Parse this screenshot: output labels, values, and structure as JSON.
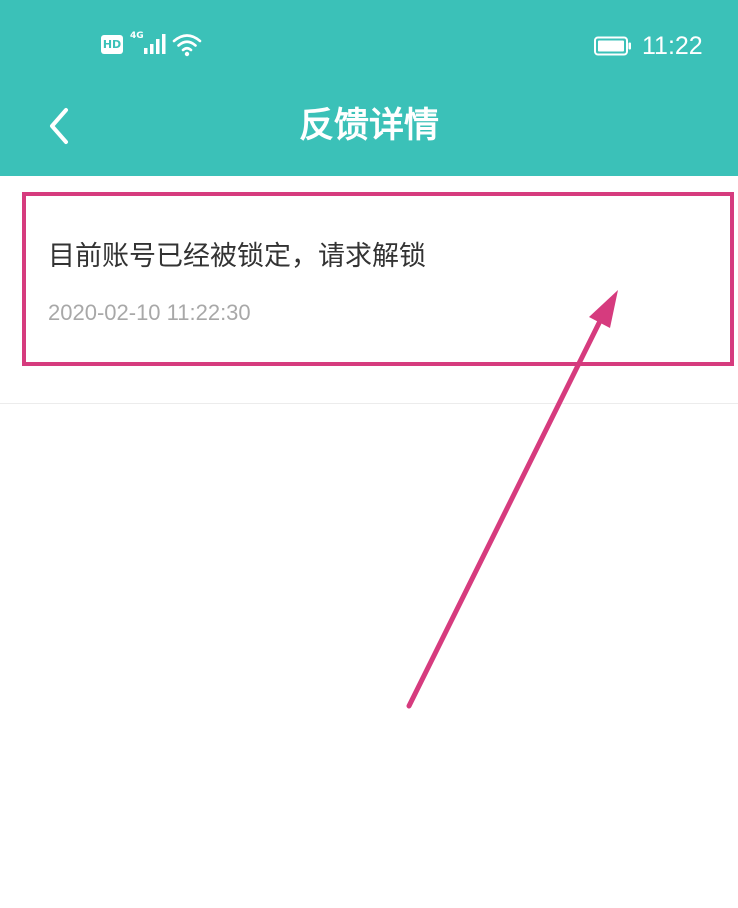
{
  "status_bar": {
    "hd_label": "HD",
    "network_label": "4G",
    "signal_icon": "signal-bars-icon",
    "wifi_icon": "wifi-icon",
    "battery_icon": "battery-icon",
    "time": "11:22"
  },
  "nav": {
    "back_icon": "chevron-left-icon",
    "title": "反馈详情"
  },
  "feedback": {
    "content": "目前账号已经被锁定，请求解锁",
    "timestamp": "2020-02-10 11:22:30"
  },
  "colors": {
    "header_bg": "#3bc1b8",
    "annotation": "#d63b7e",
    "primary_text": "#333333",
    "secondary_text": "#a8a8a8"
  }
}
